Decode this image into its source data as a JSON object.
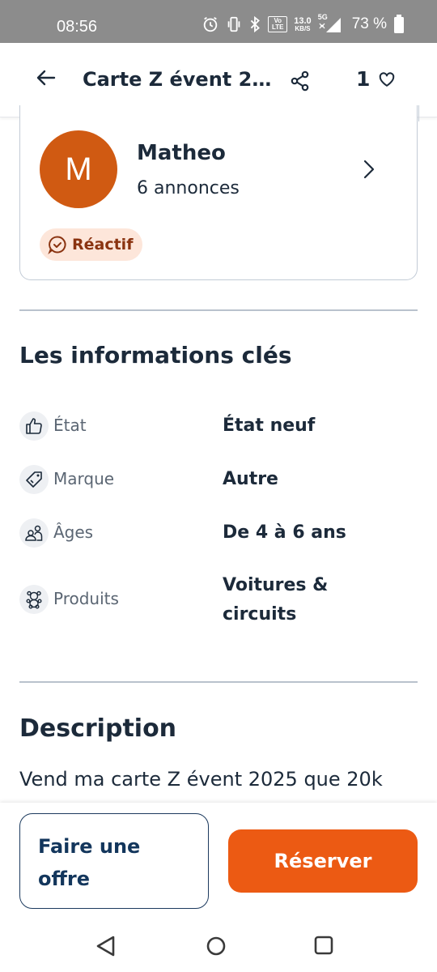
{
  "status_bar": {
    "time": "08:56",
    "net_speed_value": "13.0",
    "net_speed_unit": "KB/S",
    "network": "5G",
    "volte": "Vo LTE",
    "battery": "73 %"
  },
  "header": {
    "title": "Carte Z évent 2…",
    "favorite_count": "1"
  },
  "seller": {
    "avatar_letter": "M",
    "name": "Matheo",
    "ads_count": "6 annonces",
    "badge": "Réactif"
  },
  "key_info": {
    "title": "Les informations clés",
    "rows": [
      {
        "label": "État",
        "value": "État neuf",
        "icon": "thumbs-up-icon"
      },
      {
        "label": "Marque",
        "value": "Autre",
        "icon": "tag-icon"
      },
      {
        "label": "Âges",
        "value": "De 4 à 6 ans",
        "icon": "people-icon"
      },
      {
        "label": "Produits",
        "value": "Voitures & circuits",
        "icon": "teddy-bear-icon"
      }
    ]
  },
  "description": {
    "title": "Description",
    "text": "Vend ma carte Z évent 2025 que 20k"
  },
  "actions": {
    "offer_label": "Faire une offre",
    "reserve_label": "Réserver"
  },
  "colors": {
    "accent": "#ec5a13",
    "avatar": "#d05a12",
    "primary_text": "#1c2a3a",
    "badge_bg": "#fde6da"
  }
}
